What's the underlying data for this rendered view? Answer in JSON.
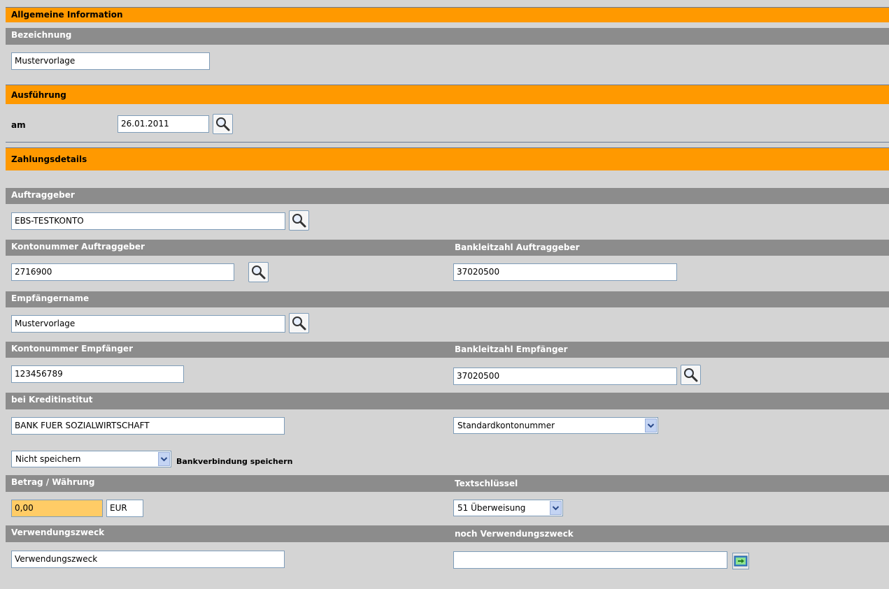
{
  "sections": {
    "general": {
      "title": "Allgemeine Information",
      "bezeichnung_label": "Bezeichnung",
      "bezeichnung_value": "Mustervorlage"
    },
    "execution": {
      "title": "Ausführung",
      "am_label": "am",
      "date_value": "26.01.2011"
    },
    "payment": {
      "title": "Zahlungsdetails"
    }
  },
  "payment": {
    "auftraggeber_label": "Auftraggeber",
    "auftraggeber_value": "EBS-TESTKONTO",
    "kontonummer_auftraggeber_label": "Kontonummer Auftraggeber",
    "kontonummer_auftraggeber_value": "2716900",
    "blz_auftraggeber_label": "Bankleitzahl Auftraggeber",
    "blz_auftraggeber_value": "37020500",
    "empfaenger_label": "Empfängername",
    "empfaenger_value": "Mustervorlage",
    "kontonummer_empfaenger_label": "Kontonummer Empfänger",
    "kontonummer_empfaenger_value": "123456789",
    "blz_empfaenger_label": "Bankleitzahl Empfänger",
    "blz_empfaenger_value": "37020500",
    "kreditinstitut_label": "bei Kreditinstitut",
    "kreditinstitut_value": "BANK FUER SOZIALWIRTSCHAFT",
    "kontonummer_select": "Standardkontonummer",
    "speichern_select": "Nicht speichern",
    "speichern_label": "Bankverbindung speichern",
    "betrag_label": "Betrag / Währung",
    "betrag_value": "0,00",
    "waehrung_value": "EUR",
    "textschluessel_label": "Textschlüssel",
    "textschluessel_select": "51 Überweisung",
    "verwendungszweck_label": "Verwendungszweck",
    "verwendungszweck_value": "Verwendungszweck",
    "noch_verwendungszweck_label": "noch Verwendungszweck",
    "noch_verwendungszweck_value": ""
  },
  "icons": {
    "search": "magnifier-icon",
    "dropdown": "chevron-down-icon",
    "add": "arrow-right-icon"
  },
  "colors": {
    "section": "#ff9900",
    "subheader": "#8c8c8c",
    "background": "#d4d4d4",
    "highlight": "#ffcc66"
  }
}
